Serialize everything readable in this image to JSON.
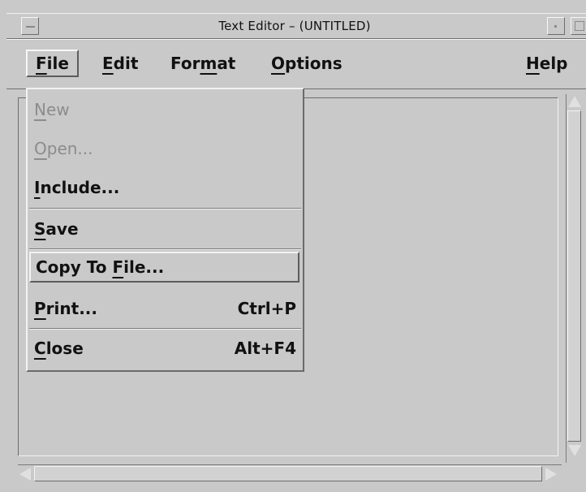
{
  "window": {
    "title": "Text Editor – (UNTITLED)",
    "colors": {
      "chrome": "#c9c9c9",
      "text": "#111111",
      "disabled": "#8c8c8c"
    }
  },
  "menubar": {
    "file": {
      "pre": "",
      "u": "F",
      "post": "ile"
    },
    "edit": {
      "pre": "",
      "u": "E",
      "post": "dit"
    },
    "format": {
      "pre": "For",
      "u": "m",
      "post": "at"
    },
    "options": {
      "pre": "",
      "u": "O",
      "post": "ptions"
    },
    "help": {
      "pre": "",
      "u": "H",
      "post": "elp"
    }
  },
  "file_menu": {
    "new": {
      "pre": "",
      "u": "N",
      "post": "ew"
    },
    "open": {
      "pre": "",
      "u": "O",
      "post": "pen..."
    },
    "include": {
      "pre": "",
      "u": "I",
      "post": "nclude..."
    },
    "save": {
      "pre": "",
      "u": "S",
      "post": "ave"
    },
    "copy_to_file": {
      "pre": "Copy To ",
      "u": "F",
      "post": "ile..."
    },
    "print": {
      "pre": "",
      "u": "P",
      "post": "rint...",
      "accel": "Ctrl+P"
    },
    "close": {
      "pre": "",
      "u": "C",
      "post": "lose",
      "accel": "Alt+F4"
    }
  },
  "icons": [
    "window-menu-icon",
    "minimize-icon",
    "maximize-icon",
    "scroll-up-icon",
    "scroll-down-icon",
    "scroll-left-icon",
    "scroll-right-icon"
  ]
}
